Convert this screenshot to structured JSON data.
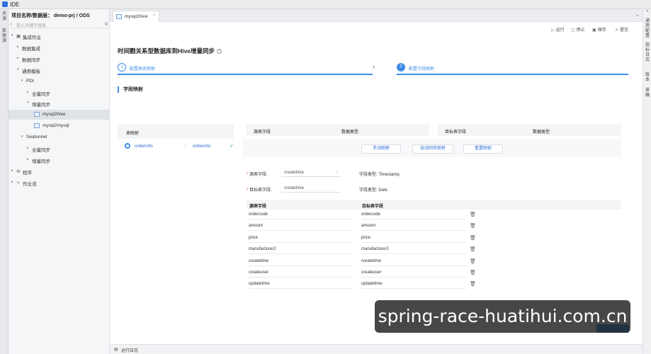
{
  "app": {
    "title": "IDE"
  },
  "left_strip": {
    "tabs": [
      "资",
      "源",
      "数",
      "据",
      "源"
    ]
  },
  "sidebar": {
    "project_label": "项目名称/数据层：  demo-prj / ODS",
    "search_placeholder": "输入关键字搜索",
    "tree": [
      {
        "label": "集成作业",
        "level": 0,
        "expanded": true,
        "icon": "folder"
      },
      {
        "label": "数据集成",
        "level": 1,
        "expanded": false
      },
      {
        "label": "数据同步",
        "level": 1,
        "expanded": false
      },
      {
        "label": "通用模板",
        "level": 1,
        "expanded": true
      },
      {
        "label": "PDI",
        "level": 2,
        "expanded": true
      },
      {
        "label": "全量同步",
        "level": 3,
        "expanded": false
      },
      {
        "label": "增量同步",
        "level": 3,
        "expanded": true
      },
      {
        "label": "mysql2hive",
        "level": 4,
        "file": true,
        "selected": true
      },
      {
        "label": "mysql2mysql",
        "level": 4,
        "file": true
      },
      {
        "label": "Seatunnel",
        "level": 2,
        "expanded": true
      },
      {
        "label": "全量同步",
        "level": 3,
        "expanded": false
      },
      {
        "label": "增量同步",
        "level": 3,
        "expanded": false
      },
      {
        "label": "程序",
        "level": 0,
        "expanded": false,
        "icon": "gear"
      },
      {
        "label": "作业流",
        "level": 0,
        "expanded": false,
        "icon": "flow"
      }
    ]
  },
  "right_strip": {
    "groups": [
      [
        "通",
        "用",
        "配",
        "置"
      ],
      [
        "指",
        "标",
        "日",
        "志"
      ],
      [
        "版",
        "本"
      ],
      [
        "草",
        "稿"
      ]
    ]
  },
  "tabs": [
    {
      "label": "mysql2hive",
      "close": "×"
    }
  ],
  "toolbar": {
    "run": "运行",
    "stop": "停止",
    "save": "保存",
    "submit": "提交"
  },
  "page": {
    "title": "时间戳关系型数据库到Hive增量同步",
    "help": "?"
  },
  "steps": [
    {
      "num": "1",
      "label": "配置表名映射"
    },
    {
      "num": "2",
      "label": "配置字段映射"
    }
  ],
  "section": {
    "title": "字段映射"
  },
  "table_mapping": {
    "header": "表映射",
    "rows": [
      {
        "source": "orderinfo",
        "target": "orderinfo"
      }
    ]
  },
  "columns_source": {
    "field": "源表字段",
    "type": "数据类型"
  },
  "columns_target": {
    "field": "目标表字段",
    "type": "数据类型"
  },
  "buttons": {
    "manual": "手动映射",
    "auto": "自动同名映射",
    "reset": "重置映射"
  },
  "detail": {
    "source_label": "源表字段:",
    "source_value": "createtime",
    "source_type_label": "字段类型:",
    "source_type": "Timestamp",
    "target_label": "目标表字段:",
    "target_value": "createtime",
    "target_type_label": "字段类型:",
    "target_type": "Date"
  },
  "field_table": {
    "headers": [
      "源表字段",
      "目标表字段"
    ],
    "rows": [
      [
        "ordercode",
        "ordercode"
      ],
      [
        "amount",
        "amount"
      ],
      [
        "price",
        "price"
      ],
      [
        "manufacturer2",
        "manufacturer2"
      ],
      [
        "createtime",
        "createtime"
      ],
      [
        "createuser",
        "createuser"
      ],
      [
        "updatetime",
        "updatetime"
      ]
    ]
  },
  "bottom": {
    "log": "运行日志"
  },
  "watermark": "spring-race-huatihui.com.cn"
}
